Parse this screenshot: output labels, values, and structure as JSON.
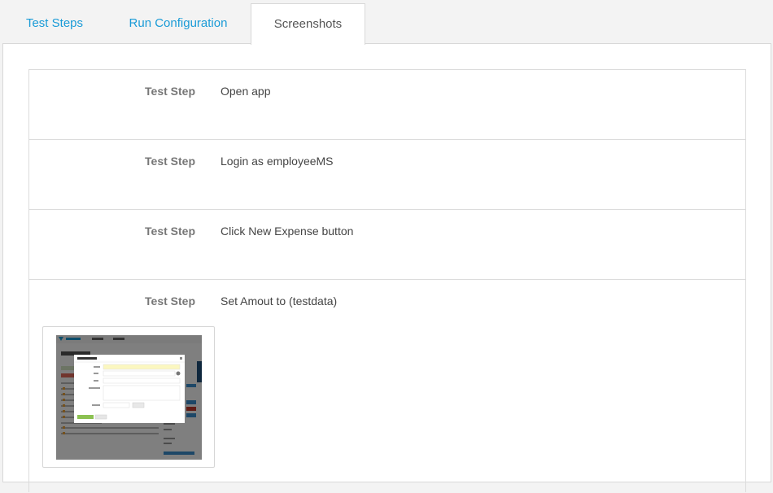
{
  "tabs": [
    {
      "label": "Test Steps",
      "active": false
    },
    {
      "label": "Run Configuration",
      "active": false
    },
    {
      "label": "Screenshots",
      "active": true
    }
  ],
  "steps": [
    {
      "label": "Test Step",
      "text": "Open app"
    },
    {
      "label": "Test Step",
      "text": "Login as employeeMS"
    },
    {
      "label": "Test Step",
      "text": "Click New Expense button"
    },
    {
      "label": "Test Step",
      "text": "Set Amout to (testdata)"
    }
  ],
  "thumbnail": {
    "app_name": "Company Name",
    "page_title": "My Expenses",
    "dialog_title": "New Expense",
    "dialog_fields": [
      "Amount",
      "Date",
      "Type",
      "Description",
      "Receipt"
    ],
    "feedback_label": "Feedback"
  },
  "colors": {
    "tab_link": "#1a9bd7",
    "label": "#777777",
    "text": "#444444",
    "border": "#dcdcdc"
  }
}
